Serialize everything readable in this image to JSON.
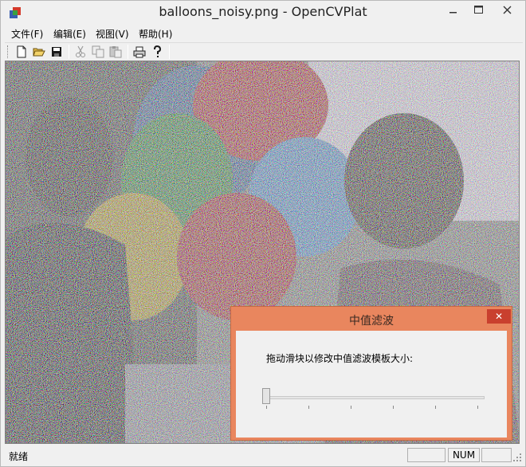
{
  "window": {
    "title": "balloons_noisy.png - OpenCVPlat"
  },
  "menu": {
    "items": [
      "文件(F)",
      "编辑(E)",
      "视图(V)",
      "帮助(H)"
    ]
  },
  "toolbar": {
    "buttons": [
      "new-icon",
      "open-icon",
      "save-icon",
      "cut-icon",
      "copy-icon",
      "paste-icon",
      "print-icon",
      "help-icon"
    ]
  },
  "dialog": {
    "title": "中值滤波",
    "label": "拖动滑块以修改中值滤波模板大小:",
    "close_glyph": "✕",
    "slider_value": 0.0
  },
  "status": {
    "ready": "就绪",
    "num": "NUM"
  },
  "colors": {
    "dialog_frame": "#e9865e",
    "close_button": "#c9402e"
  }
}
